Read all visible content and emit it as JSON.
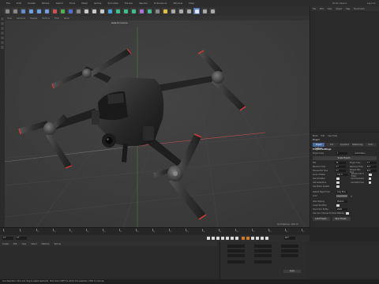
{
  "menubar": {
    "items": [
      "File",
      "Edit",
      "Create",
      "Modes",
      "Select",
      "Tools",
      "Mesh",
      "Spline",
      "Simulate",
      "Tracker",
      "Render",
      "Extensions",
      "Window",
      "Help"
    ],
    "node_space_label": "Node Space:",
    "layout_label": "Layout:"
  },
  "viewport": {
    "menu": [
      "View",
      "Cameras",
      "Display",
      "Options",
      "Filter",
      "Panel"
    ],
    "camera_label": "Default Camera",
    "status": "Grid Spacing : 100 cm"
  },
  "objects_panel": {
    "tabs": [
      "File",
      "Edit",
      "View",
      "Object",
      "Tags",
      "Bookmarks"
    ]
  },
  "attributes": {
    "tabs": [
      "Mode",
      "Edit",
      "User Data"
    ],
    "title": "Project",
    "subtabs": [
      "Project Settings",
      "Info",
      "Dynamics",
      "Referencing",
      "To Do"
    ],
    "section_title": "Project Settings",
    "project_scale_label": "Project Scale",
    "project_scale_value": "1",
    "scale_unit": "Centimeters",
    "scale_project_button": "Scale Project...",
    "rows": [
      {
        "label": "FPS",
        "value": "30",
        "label2": "Project Time",
        "value2": "0 F"
      },
      {
        "label": "Minimum Time",
        "value": "0 F",
        "label2": "Maximum Time",
        "value2": "90 F"
      },
      {
        "label": "Preview Min Time",
        "value": "0 F",
        "label2": "Preview Max Time",
        "value2": "90 F"
      },
      {
        "label": "Level of Detail",
        "value": "100 %",
        "label2": "Render LOD in Editor",
        "value2": ""
      }
    ],
    "checks": [
      {
        "label": "Use Animation",
        "label2": "Use Expression"
      },
      {
        "label": "Use Generators",
        "label2": "Use Deformers"
      },
      {
        "label": "Use Motion System",
        "label2": ""
      }
    ],
    "default_object_color_label": "Default Object Color",
    "default_object_color_value": "Gray Blue",
    "color_label": "Color",
    "view_clipping_label": "View Clipping",
    "view_clipping_value": "Medium",
    "linear_workflow_label": "Linear Workflow",
    "input_color_profile_label": "Input Color Profile",
    "input_color_profile_value": "sRGB",
    "use_color_channel_label": "Use Color Channel for Node Material",
    "load_preset_button": "Load Preset...",
    "save_preset_button": "Save Preset..."
  },
  "timeline": {
    "ticks": [
      "0",
      "5",
      "10",
      "15",
      "20",
      "25",
      "30",
      "35",
      "40",
      "45",
      "50",
      "55",
      "60",
      "65",
      "70",
      "75",
      "80",
      "85",
      "90"
    ],
    "start_field": "0 F",
    "end_field": "90 F",
    "current_field": "0 F"
  },
  "material_manager": {
    "menu": [
      "Create",
      "Edit",
      "View",
      "Select",
      "Material",
      "Texture"
    ]
  },
  "coordinates": {
    "apply_label": "Apply"
  },
  "statusbar": {
    "text": "Live Selection: Click and drag to select elements. Hold down SHIFT to add to the selection, CTRL to remove."
  },
  "colors": {
    "accent_blue": "#4a6b9b",
    "rotor_red": "#d23a3a",
    "axis_red": "#c85050",
    "transport_orange": "#d07a2a"
  }
}
